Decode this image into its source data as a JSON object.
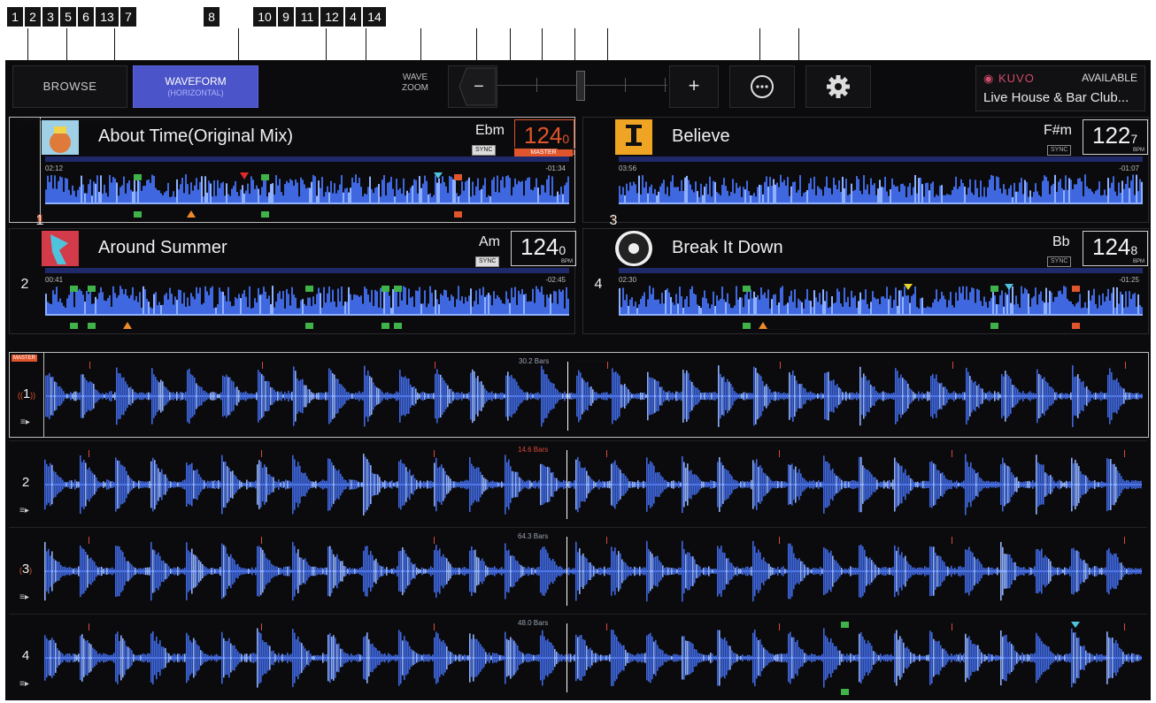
{
  "callouts": [
    "1",
    "2",
    "3",
    "5",
    "6",
    "13",
    "7",
    "8",
    "10",
    "9",
    "11",
    "12",
    "4",
    "14"
  ],
  "topbar": {
    "browse_label": "BROWSE",
    "waveform_label": "WAVEFORM",
    "waveform_sub": "(HORIZONTAL)",
    "wave_zoom_label": "WAVE ZOOM",
    "zoom_minus": "−",
    "zoom_plus": "+",
    "more_icon": "more-icon",
    "settings_icon": "gear-icon"
  },
  "kuvo": {
    "logo": "KUVO",
    "status": "AVAILABLE",
    "venue": "Live House & Bar Club..."
  },
  "decks": [
    {
      "number": "1",
      "title": "About Time(Original Mix)",
      "key": "Ebm",
      "bpm_main": "124",
      "bpm_dec": "0",
      "sync": "SYNC",
      "master": "MASTER",
      "elapsed": "02:12",
      "remaining": "-01:34",
      "bpm_unit": ""
    },
    {
      "number": "3",
      "title": "Believe",
      "key": "F#m",
      "bpm_main": "122",
      "bpm_dec": "7",
      "sync": "SYNC",
      "elapsed": "03:56",
      "remaining": "-01:07",
      "bpm_unit": "BPM"
    },
    {
      "number": "2",
      "title": "Around Summer",
      "key": "Am",
      "bpm_main": "124",
      "bpm_dec": "0",
      "sync": "SYNC",
      "elapsed": "00:41",
      "remaining": "-02:45",
      "bpm_unit": "BPM"
    },
    {
      "number": "4",
      "title": "Break It Down",
      "key": "Bb",
      "bpm_main": "124",
      "bpm_dec": "8",
      "sync": "SYNC",
      "elapsed": "02:30",
      "remaining": "-01:25",
      "bpm_unit": "BPM"
    }
  ],
  "rows": [
    {
      "number": "1",
      "badge": "MASTER",
      "label": "30.2 Bars",
      "label_color": "#9aa2b4"
    },
    {
      "number": "2",
      "label": "14.6 Bars",
      "label_color": "#d84a3a"
    },
    {
      "number": "3",
      "label": "64.3 Bars",
      "label_color": "#9aa2b4"
    },
    {
      "number": "4",
      "label": "48.0 Bars",
      "label_color": "#9aa2b4"
    }
  ],
  "colors": {
    "waveform_blue": "#3f68e0",
    "waveform_light": "#8fb0ff",
    "accent_orange": "#e0552c",
    "cue_green": "#3fb34a",
    "waveform_button": "#4b54c8"
  }
}
